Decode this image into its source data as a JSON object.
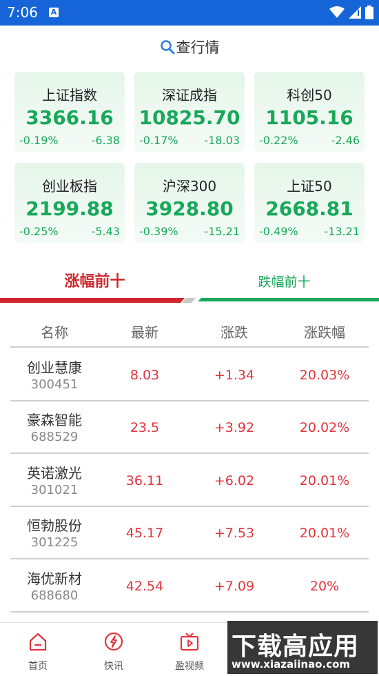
{
  "status_bar": {
    "time": "7:06",
    "a_badge": "A"
  },
  "search": {
    "label": "查行情"
  },
  "indices": [
    {
      "name": "上证指数",
      "value": "3366.16",
      "pct": "-0.19%",
      "change": "-6.38"
    },
    {
      "name": "深证成指",
      "value": "10825.70",
      "pct": "-0.17%",
      "change": "-18.03"
    },
    {
      "name": "科创50",
      "value": "1105.16",
      "pct": "-0.22%",
      "change": "-2.46"
    },
    {
      "name": "创业板指",
      "value": "2199.88",
      "pct": "-0.25%",
      "change": "-5.43"
    },
    {
      "name": "沪深300",
      "value": "3928.80",
      "pct": "-0.39%",
      "change": "-15.21"
    },
    {
      "name": "上证50",
      "value": "2668.81",
      "pct": "-0.49%",
      "change": "-13.21"
    }
  ],
  "tabs": {
    "gainers": "涨幅前十",
    "losers": "跌幅前十"
  },
  "colors": {
    "accent_red": "#d0262c",
    "accent_green": "#18a85a",
    "status_bar": "#1565d8"
  },
  "table": {
    "headers": [
      "名称",
      "最新",
      "涨跌",
      "涨跌幅"
    ],
    "rows": [
      {
        "name": "创业慧康",
        "code": "300451",
        "latest": "8.03",
        "change": "+1.34",
        "pct": "20.03%"
      },
      {
        "name": "豪森智能",
        "code": "688529",
        "latest": "23.5",
        "change": "+3.92",
        "pct": "20.02%"
      },
      {
        "name": "英诺激光",
        "code": "301021",
        "latest": "36.11",
        "change": "+6.02",
        "pct": "20.01%"
      },
      {
        "name": "恒勃股份",
        "code": "301225",
        "latest": "45.17",
        "change": "+7.53",
        "pct": "20.01%"
      },
      {
        "name": "海优新材",
        "code": "688680",
        "latest": "42.54",
        "change": "+7.09",
        "pct": "20%"
      }
    ]
  },
  "bottom_nav": [
    {
      "label": "首页",
      "icon": "home-icon"
    },
    {
      "label": "快讯",
      "icon": "flash-icon"
    },
    {
      "label": "盈视频",
      "icon": "tv-icon"
    }
  ],
  "watermark": {
    "line1": "下载高应用",
    "line2": "www.xiazaiinao.com"
  }
}
